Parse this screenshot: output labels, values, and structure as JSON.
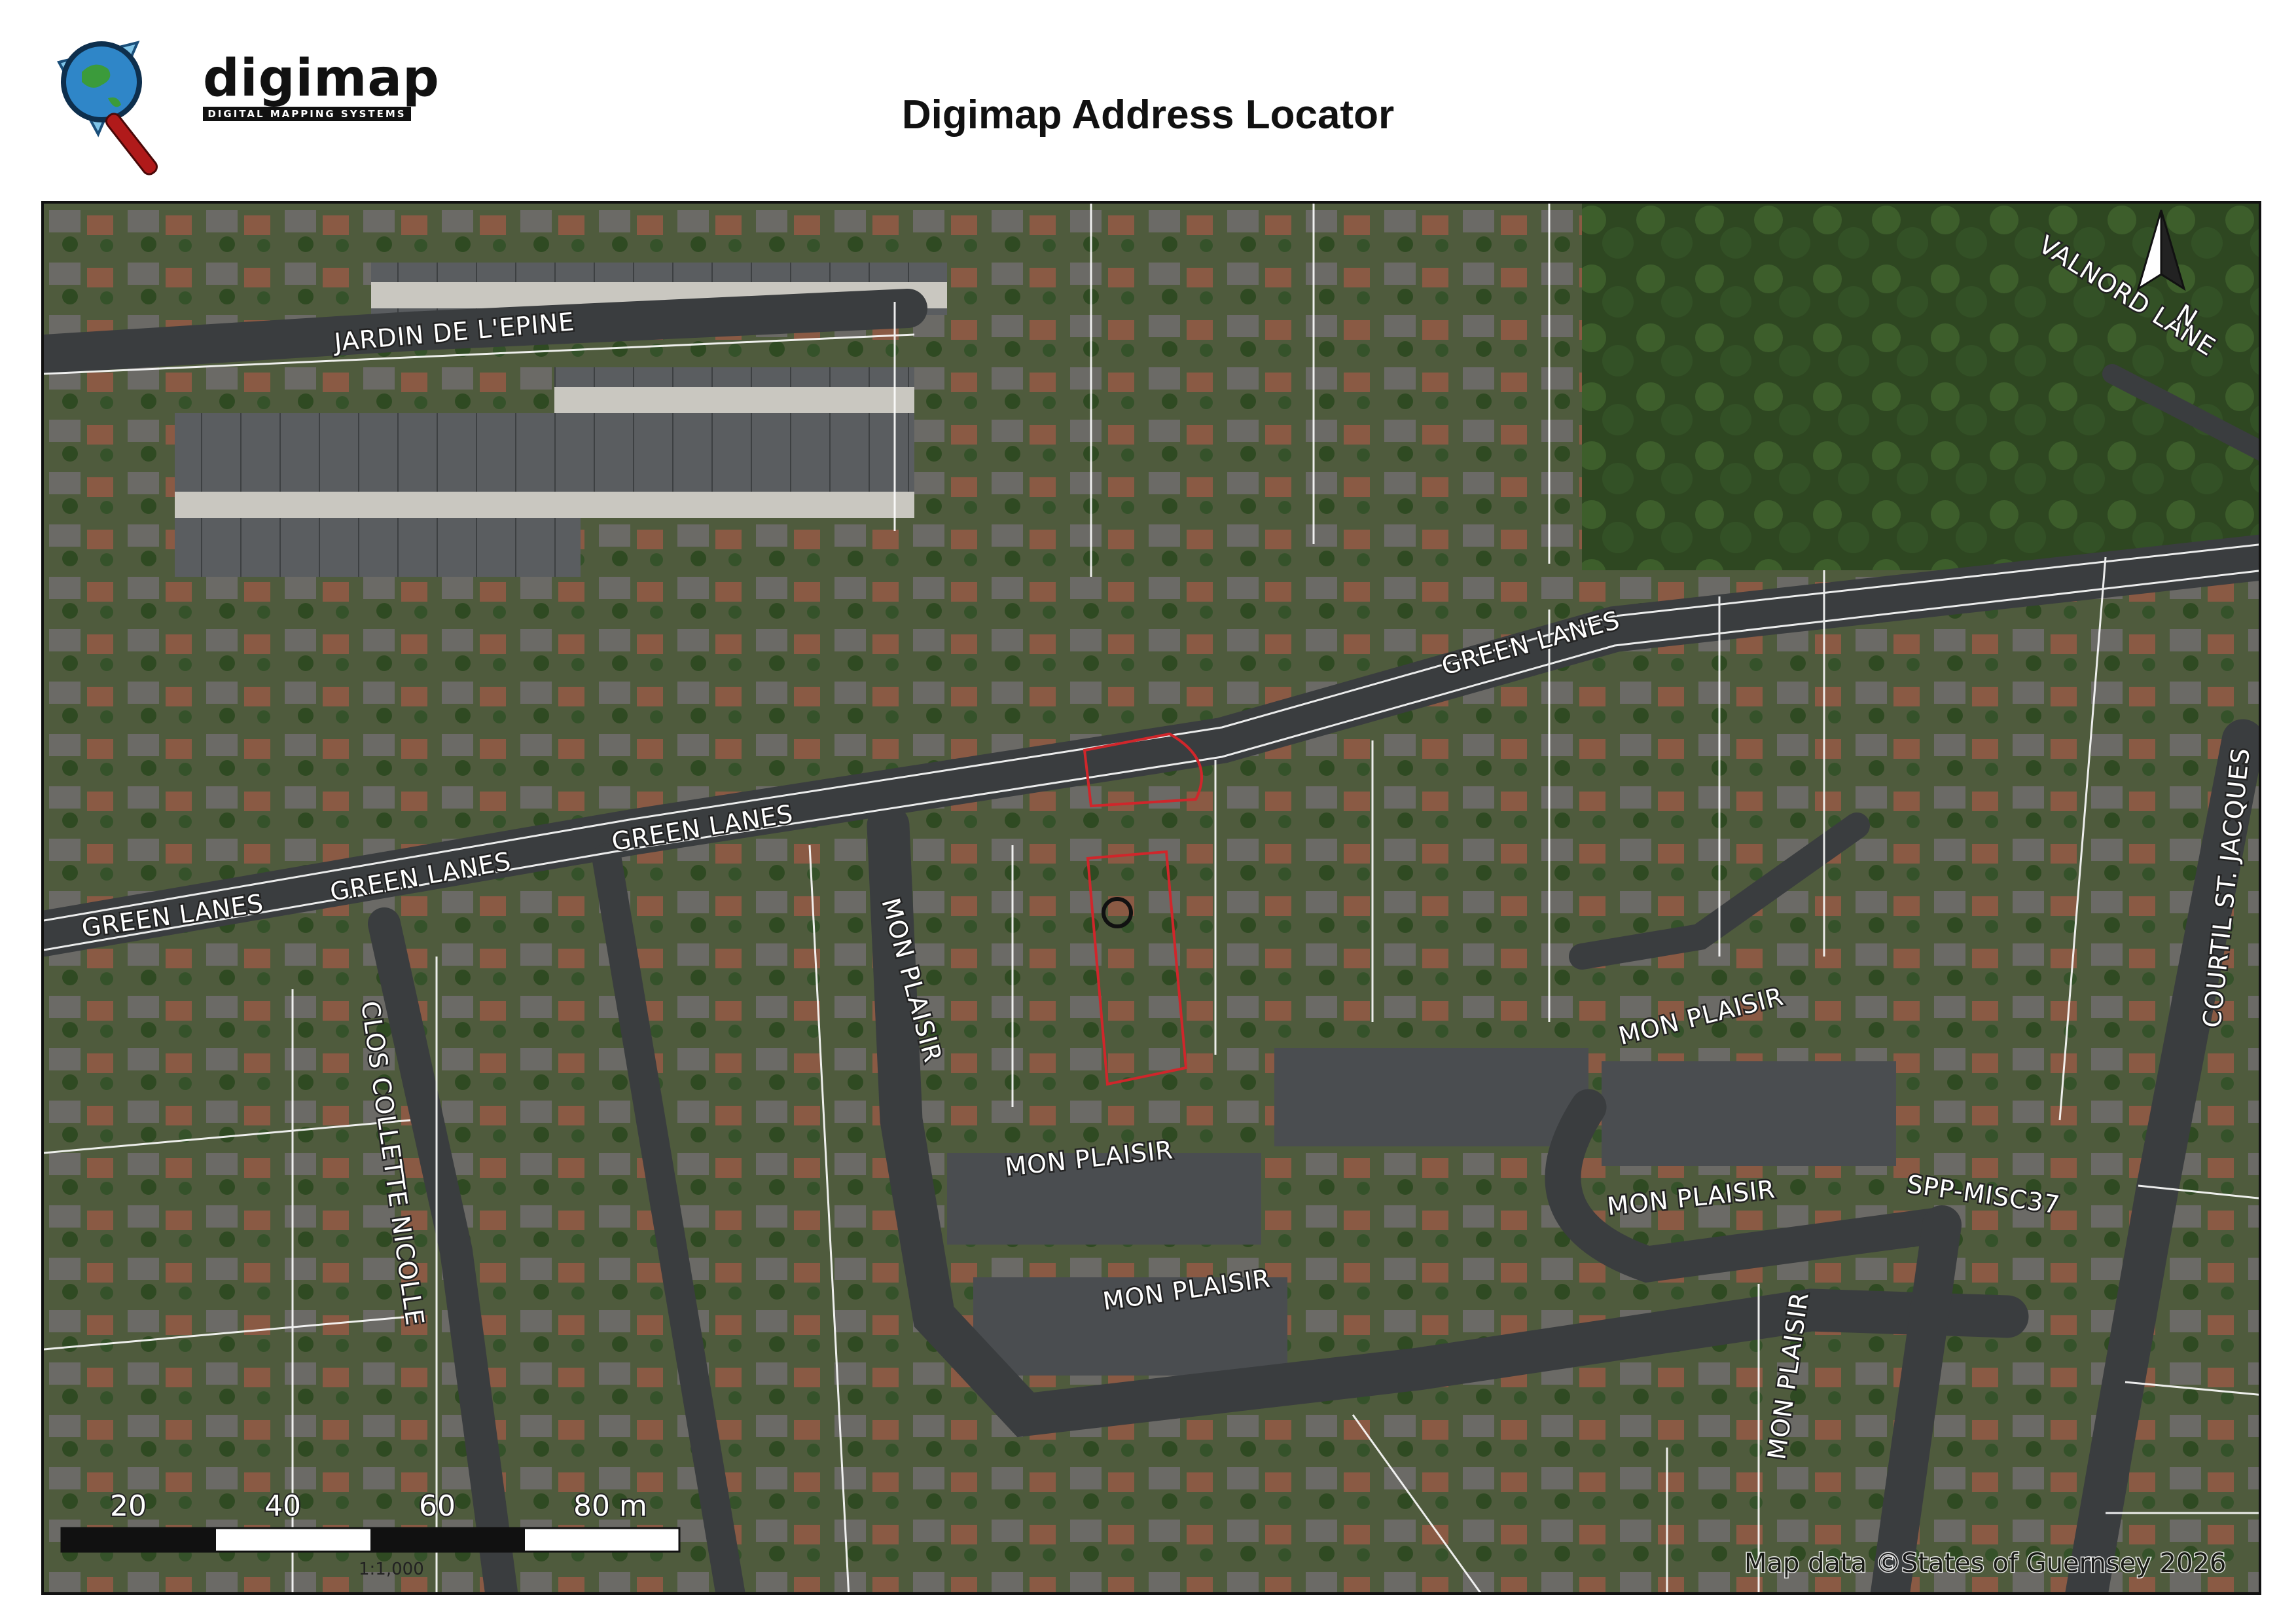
{
  "header": {
    "logo_text": "digimap",
    "logo_tagline": "DIGITAL MAPPING SYSTEMS",
    "logo_icon": "magnifier-globe-icon",
    "title": "Digimap Address Locator"
  },
  "map": {
    "road_labels": {
      "jardin": "JARDIN DE L'EPINE",
      "valnord": "VALNORD LANE",
      "green1": "GREEN LANES",
      "green2": "GREEN LANES",
      "green3": "GREEN LANES",
      "green4": "GREEN LANES",
      "mon1": "MON PLAISIR",
      "mon2": "MON PLAISIR",
      "mon3": "MON PLAISIR",
      "mon4": "MON PLAISIR",
      "mon5": "MON PLAISIR",
      "mon6": "MON PLAISIR",
      "clos": "CLOS COLLETTE NICOLLE",
      "courtil": "COURTIL ST. JACQUES",
      "spp": "SPP-MISC37"
    },
    "north_arrow": {
      "icon": "north-arrow-icon",
      "label": "N"
    },
    "scale_bar": {
      "labels": [
        "20",
        "40",
        "60",
        "80 m"
      ],
      "ratio": "1:1,000"
    },
    "attribution": "Map data ©States of Guernsey 2026",
    "colors": {
      "plot_outline": "#d0262b",
      "parcel_lines": "#ffffff",
      "road_surface": "#3a3d3f",
      "vegetation": "#3f5a2e"
    }
  }
}
